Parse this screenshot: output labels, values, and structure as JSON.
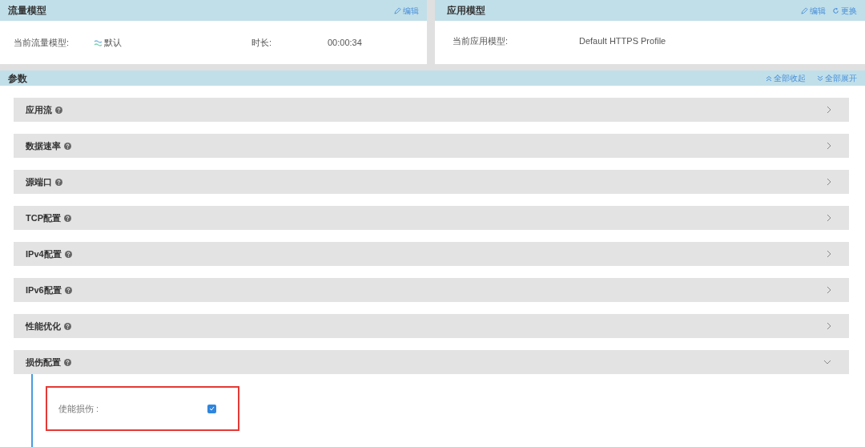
{
  "traffic_model": {
    "title": "流量模型",
    "edit_link": "编辑",
    "fields": [
      {
        "label": "当前流量模型:",
        "value": "默认",
        "kind": "model"
      },
      {
        "label": "时长:",
        "value": "00:00:34",
        "kind": "duration"
      }
    ]
  },
  "app_model": {
    "title": "应用模型",
    "edit_link": "编辑",
    "replace_link": "更换",
    "fields": [
      {
        "label": "当前应用模型:",
        "value": "Default HTTPS Profile"
      }
    ]
  },
  "params": {
    "title": "参数",
    "collapse_all": "全部收起",
    "expand_all": "全部展开",
    "sections": [
      {
        "label": "应用流",
        "expanded": false
      },
      {
        "label": "数据速率",
        "expanded": false
      },
      {
        "label": "源端口",
        "expanded": false
      },
      {
        "label": "TCP配置",
        "expanded": false
      },
      {
        "label": "IPv4配置",
        "expanded": false
      },
      {
        "label": "IPv6配置",
        "expanded": false
      },
      {
        "label": "性能优化",
        "expanded": false
      },
      {
        "label": "损伤配置",
        "expanded": true,
        "options": [
          {
            "label": "使能损伤 :",
            "checked": true,
            "highlighted": true
          }
        ]
      }
    ]
  }
}
